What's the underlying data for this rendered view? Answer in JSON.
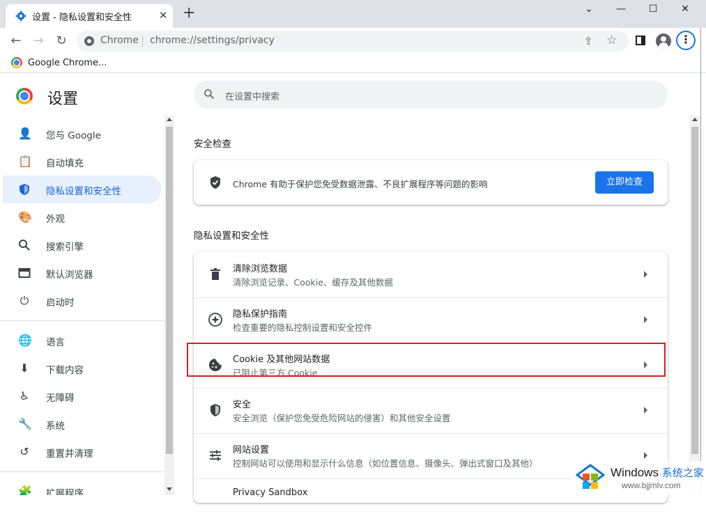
{
  "tab": {
    "title": "设置 - 隐私设置和安全性"
  },
  "window_controls": {
    "minimize": "⌄",
    "maximize": "☐",
    "close": "✕"
  },
  "toolbar": {
    "omnibox_chip": "Chrome",
    "url": "chrome://settings/privacy"
  },
  "bookmarks": [
    {
      "label": "Google Chrome..."
    }
  ],
  "settings": {
    "title": "设置",
    "search_placeholder": "在设置中搜索"
  },
  "sidebar": {
    "items": [
      {
        "label": "您与 Google",
        "icon": "person-icon"
      },
      {
        "label": "自动填充",
        "icon": "clipboard-icon"
      },
      {
        "label": "隐私设置和安全性",
        "icon": "shield-icon",
        "active": true
      },
      {
        "label": "外观",
        "icon": "palette-icon"
      },
      {
        "label": "搜索引擎",
        "icon": "search-icon"
      },
      {
        "label": "默认浏览器",
        "icon": "browser-window-icon"
      },
      {
        "label": "启动时",
        "icon": "power-icon"
      },
      {
        "label": "语言",
        "icon": "globe-icon"
      },
      {
        "label": "下载内容",
        "icon": "download-icon"
      },
      {
        "label": "无障碍",
        "icon": "accessibility-icon"
      },
      {
        "label": "系统",
        "icon": "wrench-icon"
      },
      {
        "label": "重置并清理",
        "icon": "history-icon"
      },
      {
        "label": "扩展程序",
        "icon": "puzzle-icon"
      }
    ]
  },
  "safety_check": {
    "heading": "安全检查",
    "text": "Chrome 有助于保护您免受数据泄露、不良扩展程序等问题的影响",
    "button": "立即检查"
  },
  "privacy": {
    "heading": "隐私设置和安全性",
    "rows": [
      {
        "title": "清除浏览数据",
        "subtitle": "清除浏览记录、Cookie、缓存及其他数据",
        "icon": "trash-icon"
      },
      {
        "title": "隐私保护指南",
        "subtitle": "检查重要的隐私控制设置和安全控件",
        "icon": "compass-icon"
      },
      {
        "title": "Cookie 及其他网站数据",
        "subtitle": "已阻止第三方 Cookie",
        "icon": "cookie-icon",
        "highlighted": true
      },
      {
        "title": "安全",
        "subtitle": "安全浏览（保护您免受危险网站的侵害）和其他安全设置",
        "icon": "security-shield-icon"
      },
      {
        "title": "网站设置",
        "subtitle": "控制网站可以使用和显示什么信息（如位置信息、摄像头、弹出式窗口及其他）",
        "icon": "sliders-icon"
      },
      {
        "title": "Privacy Sandbox",
        "subtitle": "",
        "icon": "sandbox-icon"
      }
    ]
  },
  "watermark": {
    "title_en": "Windows",
    "title_cn": "系统之家",
    "url": "www.bjjmlv.com"
  },
  "colors": {
    "accent": "#1a73e8",
    "active_bg": "#e8f0fe",
    "highlight": "#d21f1f"
  }
}
